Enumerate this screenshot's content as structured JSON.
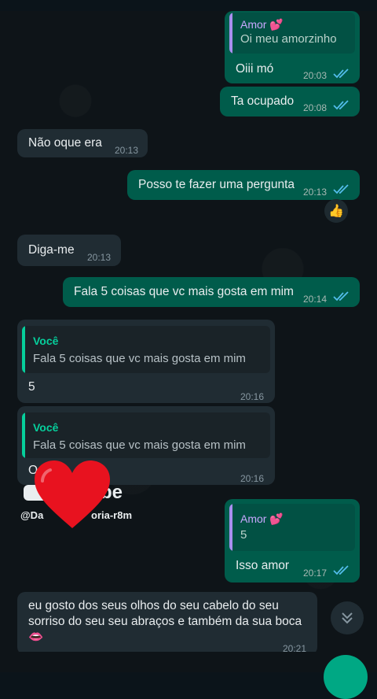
{
  "colors": {
    "background": "#0b141a",
    "outgoing_bubble": "#005c4b",
    "incoming_bubble": "#202c33",
    "read_ticks": "#53bdeb",
    "heart": "#e8121f",
    "fab": "#00a884"
  },
  "messages": [
    {
      "direction": "out",
      "quote": {
        "author": "Amor 💕",
        "text": "Oi meu amorzinho"
      },
      "text": "Oiii mó",
      "time": "20:03",
      "status": "read"
    },
    {
      "direction": "out",
      "text": "Ta ocupado",
      "time": "20:08",
      "status": "read"
    },
    {
      "direction": "in",
      "text": "Não oque era",
      "time": "20:13"
    },
    {
      "direction": "out",
      "text": "Posso te fazer uma pergunta",
      "time": "20:13",
      "status": "read",
      "reaction": "👍"
    },
    {
      "direction": "in",
      "text": "Diga-me",
      "time": "20:13"
    },
    {
      "direction": "out",
      "text": "Fala 5 coisas que vc mais gosta em mim",
      "time": "20:14",
      "status": "read"
    },
    {
      "direction": "in",
      "quote": {
        "author": "Você",
        "text": "Fala 5 coisas que vc mais gosta em mim"
      },
      "text": "5",
      "time": "20:16"
    },
    {
      "direction": "in",
      "quote": {
        "author": "Você",
        "text": "Fala 5 coisas que vc mais gosta em mim"
      },
      "text": "O",
      "time": "20:16"
    },
    {
      "direction": "out",
      "quote": {
        "author": "Amor 💕",
        "text": "5"
      },
      "text": "Isso amor",
      "time": "20:17",
      "status": "read"
    },
    {
      "direction": "in",
      "text_lines": [
        "eu gosto dos seus olhos  do seu cabelo do seu",
        "sorriso do seu seu abraços e também da sua boca",
        "👄"
      ],
      "time": "20:21"
    }
  ],
  "watermark": {
    "logo": "be",
    "handle": "@Da",
    "handle_tail": "oria-r8m"
  },
  "icons": {
    "scroll_down": "double-chevron-down-icon",
    "read_ticks": "double-check-icon",
    "overlay": "heart-icon"
  }
}
